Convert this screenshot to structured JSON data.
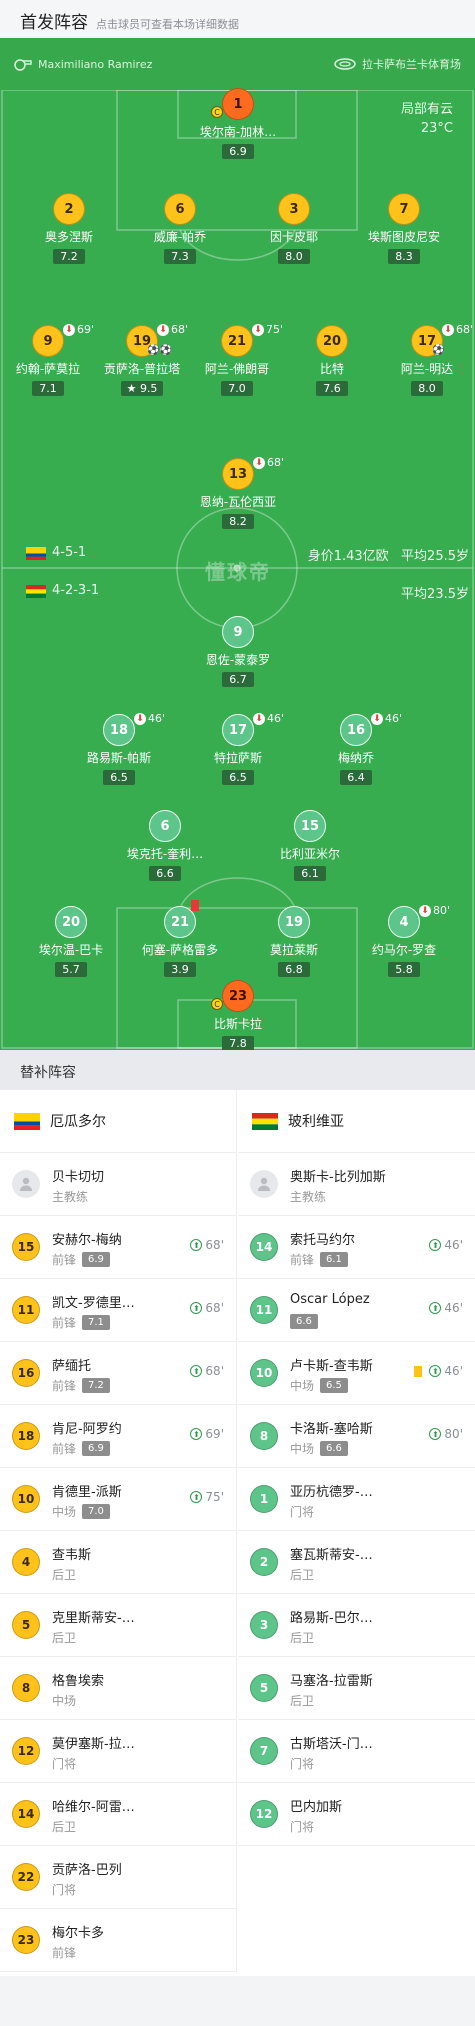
{
  "header": {
    "title": "首发阵容",
    "subtitle": "点击球员可查看本场详细数据"
  },
  "pitch": {
    "referee": "Maximiliano Ramirez",
    "venue": "拉卡萨布兰卡体育场",
    "weather": "局部有云",
    "temp": "23°C",
    "watermark": "懂球帝",
    "home": {
      "formation": "4-5-1",
      "value": "身价1.43亿欧",
      "age": "平均25.5岁"
    },
    "away": {
      "formation": "4-2-3-1",
      "age": "平均23.5岁"
    }
  },
  "home_players": [
    {
      "num": "1",
      "name": "埃尔南-加林…",
      "rating": "6.9",
      "captain": "C"
    },
    {
      "num": "2",
      "name": "奥多涅斯",
      "rating": "7.2"
    },
    {
      "num": "6",
      "name": "威廉-帕乔",
      "rating": "7.3"
    },
    {
      "num": "3",
      "name": "因卡皮耶",
      "rating": "8.0"
    },
    {
      "num": "7",
      "name": "埃斯图皮尼安",
      "rating": "8.3"
    },
    {
      "num": "9",
      "name": "约翰-萨莫拉",
      "rating": "7.1",
      "sub": "69'"
    },
    {
      "num": "19",
      "name": "贡萨洛-普拉塔",
      "rating": "9.5",
      "sub": "68'",
      "goals": "⚽⚽"
    },
    {
      "num": "21",
      "name": "阿兰-佛朗哥",
      "rating": "7.0",
      "sub": "75'"
    },
    {
      "num": "20",
      "name": "比特",
      "rating": "7.6"
    },
    {
      "num": "17",
      "name": "阿兰-明达",
      "rating": "8.0",
      "sub": "68'",
      "goals": "⚽"
    },
    {
      "num": "13",
      "name": "恩纳-瓦伦西亚",
      "rating": "8.2",
      "sub": "68'"
    }
  ],
  "away_players": [
    {
      "num": "9",
      "name": "恩佐-蒙泰罗",
      "rating": "6.7"
    },
    {
      "num": "18",
      "name": "路易斯-帕斯",
      "rating": "6.5",
      "sub": "46'"
    },
    {
      "num": "17",
      "name": "特拉萨斯",
      "rating": "6.5",
      "sub": "46'"
    },
    {
      "num": "16",
      "name": "梅纳乔",
      "rating": "6.4",
      "sub": "46'"
    },
    {
      "num": "6",
      "name": "埃克托-奎利…",
      "rating": "6.6"
    },
    {
      "num": "15",
      "name": "比利亚米尔",
      "rating": "6.1"
    },
    {
      "num": "20",
      "name": "埃尔温-巴卡",
      "rating": "5.7"
    },
    {
      "num": "21",
      "name": "何塞-萨格雷多",
      "rating": "3.9"
    },
    {
      "num": "19",
      "name": "莫拉莱斯",
      "rating": "6.8"
    },
    {
      "num": "4",
      "name": "约马尔-罗查",
      "rating": "5.8",
      "sub": "80'"
    },
    {
      "num": "23",
      "name": "比斯卡拉",
      "rating": "7.8",
      "captain": "C"
    }
  ],
  "subs_title": "替补阵容",
  "subs": {
    "home": {
      "team": "厄瓜多尔",
      "coach": {
        "name": "贝卡切切",
        "role": "主教练"
      },
      "players": [
        {
          "num": "15",
          "name": "安赫尔-梅纳",
          "pos": "前锋",
          "rating": "6.9",
          "min": "68'"
        },
        {
          "num": "11",
          "name": "凯文-罗德里…",
          "pos": "前锋",
          "rating": "7.1",
          "min": "68'"
        },
        {
          "num": "16",
          "name": "萨缅托",
          "pos": "前锋",
          "rating": "7.2",
          "min": "68'"
        },
        {
          "num": "18",
          "name": "肯尼-阿罗约",
          "pos": "前锋",
          "rating": "6.9",
          "min": "69'"
        },
        {
          "num": "10",
          "name": "肯德里-派斯",
          "pos": "中场",
          "rating": "7.0",
          "min": "75'"
        },
        {
          "num": "4",
          "name": "查韦斯",
          "pos": "后卫"
        },
        {
          "num": "5",
          "name": "克里斯蒂安-…",
          "pos": "后卫"
        },
        {
          "num": "8",
          "name": "格鲁埃索",
          "pos": "中场"
        },
        {
          "num": "12",
          "name": "莫伊塞斯-拉…",
          "pos": "门将"
        },
        {
          "num": "14",
          "name": "哈维尔-阿雷…",
          "pos": "后卫"
        },
        {
          "num": "22",
          "name": "贡萨洛-巴列",
          "pos": "门将"
        },
        {
          "num": "23",
          "name": "梅尔卡多",
          "pos": "前锋"
        }
      ]
    },
    "away": {
      "team": "玻利维亚",
      "coach": {
        "name": "奥斯卡-比列加斯",
        "role": "主教练"
      },
      "players": [
        {
          "num": "14",
          "name": "索托马约尔",
          "pos": "前锋",
          "rating": "6.1",
          "min": "46'"
        },
        {
          "num": "11",
          "name": "Óscar López",
          "pos": "",
          "rating": "6.6",
          "min": "46'"
        },
        {
          "num": "10",
          "name": "卢卡斯-查韦斯",
          "pos": "中场",
          "rating": "6.5",
          "min": "46'",
          "yellow": true
        },
        {
          "num": "8",
          "name": "卡洛斯-塞哈斯",
          "pos": "中场",
          "rating": "6.6",
          "min": "80'"
        },
        {
          "num": "1",
          "name": "亚历杭德罗-…",
          "pos": "门将"
        },
        {
          "num": "2",
          "name": "塞瓦斯蒂安-…",
          "pos": "后卫"
        },
        {
          "num": "3",
          "name": "路易斯-巴尔…",
          "pos": "后卫"
        },
        {
          "num": "5",
          "name": "马塞洛-拉雷斯",
          "pos": "后卫"
        },
        {
          "num": "7",
          "name": "古斯塔沃-门…",
          "pos": "门将"
        },
        {
          "num": "12",
          "name": "巴内加斯",
          "pos": "门将"
        }
      ]
    }
  },
  "colors": {
    "pitch": "#37ad50",
    "home_kit": "#ffc21a",
    "keeper_kit": "#ff6b1e",
    "away_kit": "#5ec58a"
  }
}
